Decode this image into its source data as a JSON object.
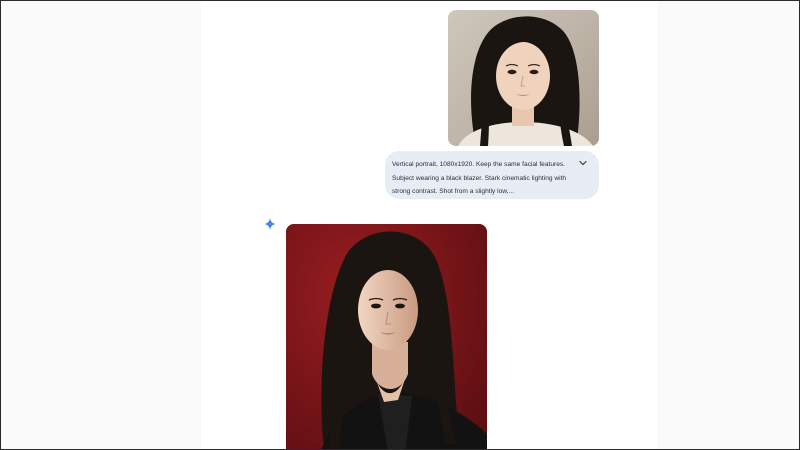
{
  "conversation": {
    "user_turn": {
      "image": {
        "alt": "uploaded portrait"
      },
      "prompt": {
        "text": "Vertical portrait, 1080x1920. Keep the same facial features. Subject wearing a black blazer. Stark cinematic lighting with strong contrast. Shot from a slightly low,...",
        "expand_icon": "chevron-down-icon"
      }
    },
    "assistant_turn": {
      "icon": "sparkle-icon",
      "image": {
        "alt": "generated portrait"
      }
    }
  },
  "colors": {
    "bubble_bg": "#e8ecf4",
    "spark": "#4a84e8",
    "result_bg": "#7d1519",
    "blazer": "#121212",
    "hair": "#1b1512"
  }
}
